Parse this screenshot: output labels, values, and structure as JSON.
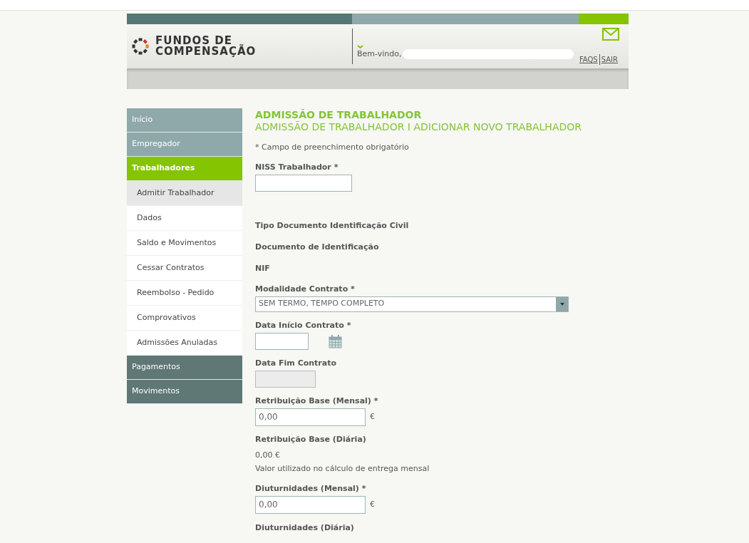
{
  "header": {
    "logo_line_1": "FUNDOS DE",
    "logo_line_2": "COMPENSAÇÃO",
    "welcome": "Bem-vindo,",
    "links": [
      "FAQS",
      "SAIR"
    ]
  },
  "sidebar": {
    "items": [
      {
        "kind": "section",
        "label": "Início",
        "selected": false,
        "color": "#8fa8aa"
      },
      {
        "kind": "section",
        "label": "Empregador",
        "selected": false,
        "color": "#8fa8aa"
      },
      {
        "kind": "section",
        "label": "Trabalhadores",
        "selected": true,
        "color": "#84c400"
      },
      {
        "kind": "sub",
        "label": "Admitir Trabalhador",
        "selected": true
      },
      {
        "kind": "sub",
        "label": "Dados",
        "selected": false
      },
      {
        "kind": "sub",
        "label": "Saldo e Movimentos",
        "selected": false
      },
      {
        "kind": "sub",
        "label": "Cessar Contratos",
        "selected": false
      },
      {
        "kind": "sub",
        "label": "Reembolso - Pedido",
        "selected": false
      },
      {
        "kind": "sub",
        "label": "Comprovativos",
        "selected": false
      },
      {
        "kind": "sub",
        "label": "Admissões Anuladas",
        "selected": false
      },
      {
        "kind": "section",
        "label": "Pagamentos",
        "selected": false,
        "color": "#5f7775"
      },
      {
        "kind": "section",
        "label": "Movimentos",
        "selected": false,
        "color": "#5f7775"
      }
    ]
  },
  "page": {
    "title": "ADMISSÃO DE TRABALHADOR",
    "subtitle": "ADMISSÃO DE TRABALHADOR I ADICIONAR NOVO TRABALHADOR",
    "required_note": "* Campo de preenchimento obrigatório"
  },
  "fields": [
    {
      "kind": "input",
      "label": "NISS Trabalhador *",
      "disabled": false
    },
    {
      "kind": "label",
      "label": "Tipo Documento Identificação Civil"
    },
    {
      "kind": "label",
      "label": "Documento de Identificação"
    },
    {
      "kind": "label",
      "label": "NIF"
    },
    {
      "kind": "select",
      "label": "Modalidade Contrato  *",
      "value": "SEM TERMO, TEMPO COMPLETO"
    },
    {
      "kind": "date",
      "label": "Data Início Contrato *"
    },
    {
      "kind": "input",
      "label": "Data Fim Contrato",
      "disabled": true
    },
    {
      "kind": "money",
      "label": "Retribuição Base (Mensal) *",
      "value": "0,00",
      "unit": "€"
    },
    {
      "kind": "readonly",
      "label": "Retribuição Base (Diária)",
      "value": "0,00 €",
      "note": "Valor utilizado no cálculo de entrega mensal"
    },
    {
      "kind": "money",
      "label": "Diuturnidades (Mensal) *",
      "value": "0,00",
      "unit": "€"
    },
    {
      "kind": "label",
      "label": "Diuturnidades (Diária)"
    }
  ]
}
